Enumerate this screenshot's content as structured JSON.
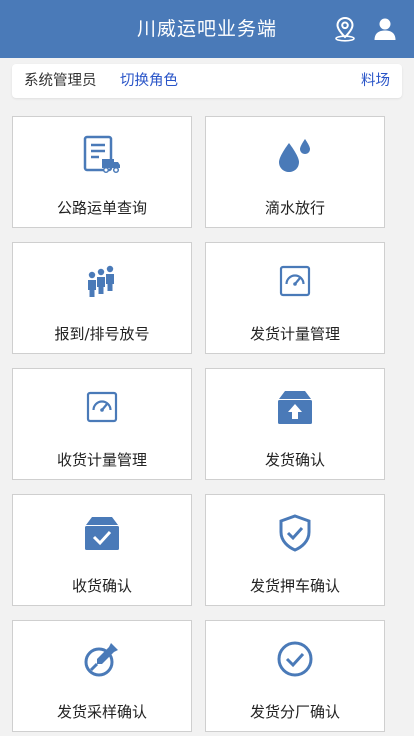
{
  "header": {
    "title": "川威运吧业务端",
    "icons": [
      "location-icon",
      "user-icon"
    ]
  },
  "rolebar": {
    "admin": "系统管理员",
    "switch_role": "切换角色",
    "place": "料场"
  },
  "tiles": [
    {
      "label": "公路运单查询",
      "icon": "waybill-truck-icon"
    },
    {
      "label": "滴水放行",
      "icon": "water-drops-icon"
    },
    {
      "label": "报到/排号放号",
      "icon": "queue-people-icon"
    },
    {
      "label": "发货计量管理",
      "icon": "scale-gauge-icon"
    },
    {
      "label": "收货计量管理",
      "icon": "scale-gauge-icon"
    },
    {
      "label": "发货确认",
      "icon": "box-upload-icon"
    },
    {
      "label": "收货确认",
      "icon": "box-check-icon"
    },
    {
      "label": "发货押车确认",
      "icon": "shield-check-icon"
    },
    {
      "label": "发货采样确认",
      "icon": "sampling-dropper-icon"
    },
    {
      "label": "发货分厂确认",
      "icon": "circle-check-icon"
    }
  ],
  "colors": {
    "header_bg": "#4a7ab8",
    "icon_blue": "#4a7ab8",
    "link_blue": "#2a55c8"
  }
}
